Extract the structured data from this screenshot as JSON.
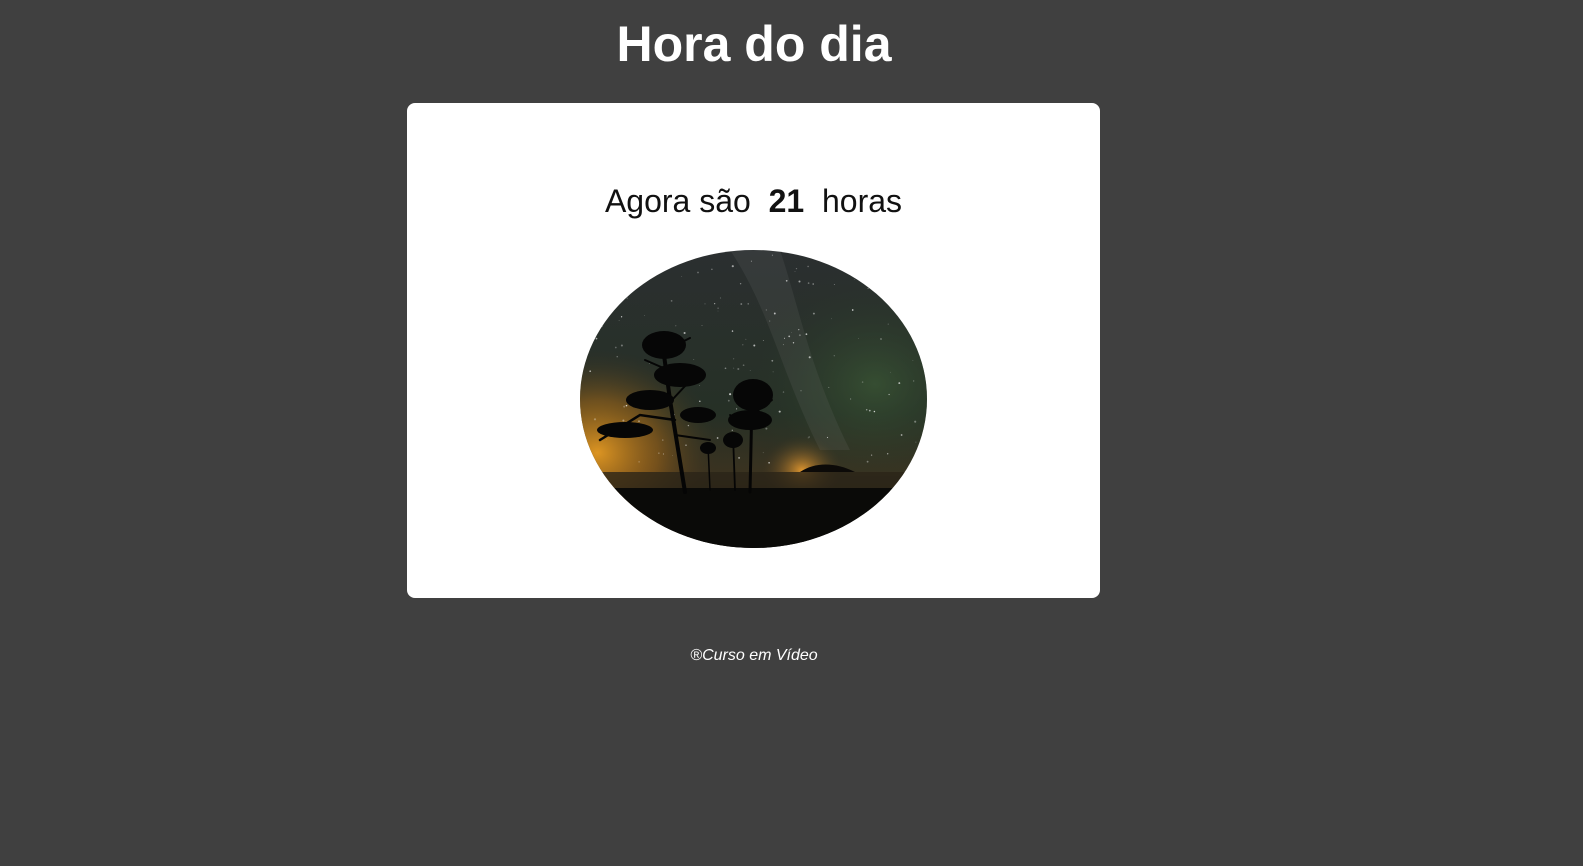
{
  "header": {
    "title": "Hora do dia"
  },
  "card": {
    "prefix": "Agora são",
    "hour": "21",
    "suffix": "horas",
    "image": {
      "depicts": "night-sky-icon",
      "sky_color": "#2a2e2a",
      "horizon_glow_color": "#d98a1c",
      "ground_color": "#0a0a08"
    }
  },
  "footer": {
    "text": "®Curso em Vídeo"
  },
  "colors": {
    "background": "#404040",
    "card": "#ffffff",
    "title_text": "#ffffff",
    "body_text": "#111111"
  }
}
